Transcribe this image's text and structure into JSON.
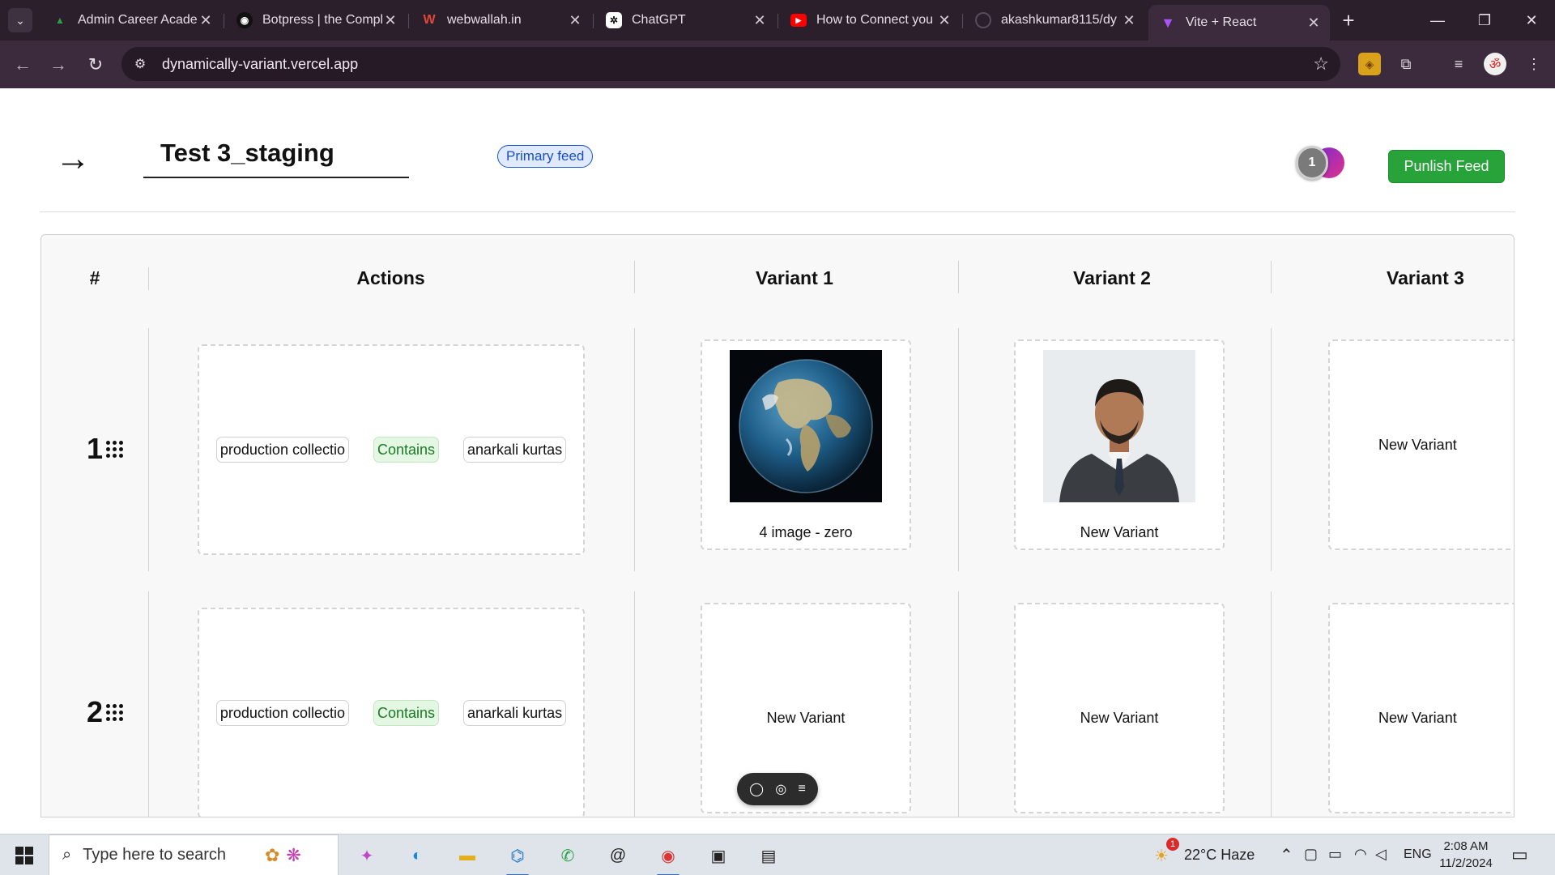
{
  "browser": {
    "tabs": [
      {
        "title": "Admin Career Acade",
        "icon": "admin-favicon",
        "color": "#2ea043"
      },
      {
        "title": "Botpress | the Compl",
        "icon": "botpress-favicon",
        "color": "#111111"
      },
      {
        "title": "webwallah.in",
        "icon": "webwallah-favicon",
        "color": "#e0483c"
      },
      {
        "title": "ChatGPT",
        "icon": "chatgpt-favicon",
        "color": "#ffffff"
      },
      {
        "title": "How to Connect you",
        "icon": "youtube-favicon",
        "color": "#ff0000"
      },
      {
        "title": "akashkumar8115/dy",
        "icon": "github-favicon",
        "color": "#24292f"
      },
      {
        "title": "Vite + React",
        "icon": "vite-favicon",
        "color": "#a855f7"
      }
    ],
    "active_tab_index": 6,
    "url": "dynamically-variant.vercel.app"
  },
  "header": {
    "feed_name": "Test 3_staging",
    "feed_badge": "Primary feed",
    "toggle_count": "1",
    "publish_label": "Punlish Feed"
  },
  "table": {
    "columns": {
      "index": "#",
      "actions": "Actions",
      "variant1": "Variant 1",
      "variant2": "Variant 2",
      "variant3": "Variant 3"
    },
    "rows": [
      {
        "number": "1",
        "filter": {
          "field": "production collectio",
          "operator": "Contains",
          "value": "anarkali kurtas"
        },
        "variants": [
          {
            "label": "4 image - zero",
            "image": "earth-globe"
          },
          {
            "label": "New Variant",
            "image": "man-in-suit-portrait"
          },
          {
            "label": "New Variant",
            "image": null
          }
        ]
      },
      {
        "number": "2",
        "filter": {
          "field": "production collectio",
          "operator": "Contains",
          "value": "anarkali kurtas"
        },
        "variants": [
          {
            "label": "New Variant",
            "image": null
          },
          {
            "label": "New Variant",
            "image": null
          },
          {
            "label": "New Variant",
            "image": null
          }
        ]
      }
    ]
  },
  "floating_toolbar": {
    "icons": [
      "comment-icon",
      "eye-icon",
      "list-icon"
    ]
  },
  "taskbar": {
    "search_placeholder": "Type here to search",
    "weather": "22°C  Haze",
    "weather_alert_count": "1",
    "language": "ENG",
    "time": "2:08 AM",
    "date": "11/2/2024"
  },
  "colors": {
    "publish": "#27a33a",
    "badge": "#1a56d6",
    "operator_chip": "#e3f7e3"
  }
}
